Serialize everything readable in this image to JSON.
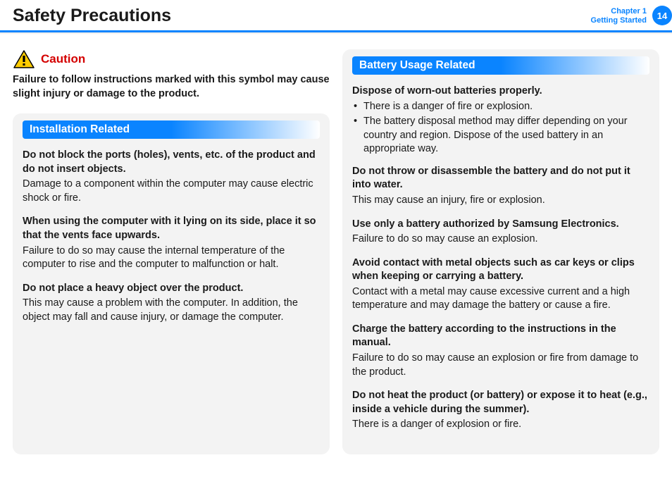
{
  "header": {
    "title": "Safety Precautions",
    "chapter_line1": "Chapter 1",
    "chapter_line2": "Getting Started",
    "page_number": "14"
  },
  "caution": {
    "label": "Caution",
    "text": "Failure to follow instructions marked with this symbol may cause slight injury or damage to the product."
  },
  "left_panel": {
    "heading": "Installation Related",
    "items": [
      {
        "head": "Do not block the ports (holes), vents, etc. of the product and do not insert objects.",
        "body": "Damage to a component within the computer may cause electric shock or fire."
      },
      {
        "head": "When using the computer with it lying on its side, place it so that the vents face upwards.",
        "body": "Failure to do so may cause the internal temperature of the computer to rise and the computer to malfunction or halt."
      },
      {
        "head": "Do not place a heavy object over the product.",
        "body": "This may cause a problem with the computer. In addition, the object may fall and cause injury, or damage the computer."
      }
    ]
  },
  "right_panel": {
    "heading": "Battery Usage Related",
    "first": {
      "head": "Dispose of worn-out batteries properly.",
      "bullets": [
        "There is a danger of fire or explosion.",
        "The battery disposal method may differ depending on your country and region. Dispose of the used battery in an appropriate way."
      ]
    },
    "items": [
      {
        "head": "Do not throw or disassemble the battery and do not put it into water.",
        "body": "This may cause an injury, fire or explosion."
      },
      {
        "head": "Use only a battery authorized by Samsung Electronics.",
        "body": "Failure to do so may cause an explosion."
      },
      {
        "head": "Avoid contact with metal objects such as car keys or clips when keeping or carrying a battery.",
        "body": "Contact with a metal may cause excessive current and a high temperature and may damage the battery or cause a fire."
      },
      {
        "head": "Charge the battery according to the instructions in the manual.",
        "body": "Failure to do so may cause an explosion or fire from damage to the product."
      },
      {
        "head": "Do not heat the product (or battery) or expose it to heat (e.g., inside a vehicle during the summer).",
        "body": "There is a danger of explosion or fire."
      }
    ]
  }
}
